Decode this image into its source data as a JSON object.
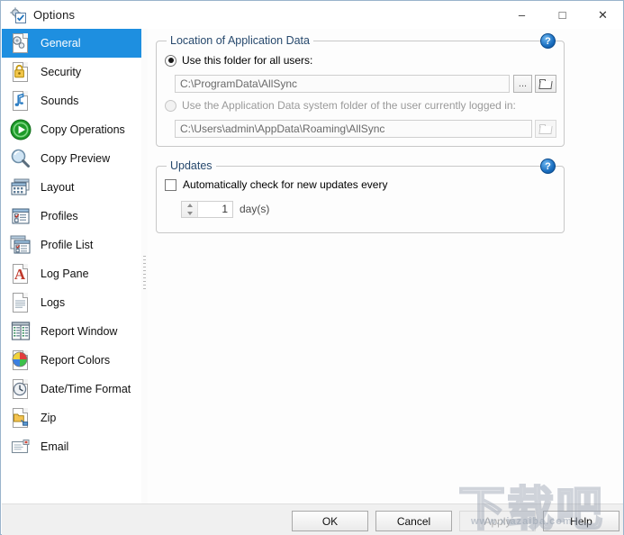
{
  "window": {
    "title": "Options",
    "icon": "options-gear-icon",
    "minimize": "–",
    "maximize": "□",
    "close": "✕"
  },
  "sidebar": {
    "items": [
      {
        "label": "General",
        "icon": "general-gear-page-icon",
        "selected": true
      },
      {
        "label": "Security",
        "icon": "padlock-page-icon",
        "selected": false
      },
      {
        "label": "Sounds",
        "icon": "music-note-page-icon",
        "selected": false
      },
      {
        "label": "Copy Operations",
        "icon": "green-play-circle-icon",
        "selected": false
      },
      {
        "label": "Copy Preview",
        "icon": "magnifier-icon",
        "selected": false
      },
      {
        "label": "Layout",
        "icon": "window-layout-icon",
        "selected": false
      },
      {
        "label": "Profiles",
        "icon": "profile-window-icon",
        "selected": false
      },
      {
        "label": "Profile List",
        "icon": "profile-list-windows-icon",
        "selected": false
      },
      {
        "label": "Log Pane",
        "icon": "red-letter-a-page-icon",
        "selected": false
      },
      {
        "label": "Logs",
        "icon": "lined-page-icon",
        "selected": false
      },
      {
        "label": "Report Window",
        "icon": "report-grid-icon",
        "selected": false
      },
      {
        "label": "Report Colors",
        "icon": "color-wheel-page-icon",
        "selected": false
      },
      {
        "label": "Date/Time Format",
        "icon": "clock-page-icon",
        "selected": false
      },
      {
        "label": "Zip",
        "icon": "zip-folder-icon",
        "selected": false
      },
      {
        "label": "Email",
        "icon": "envelope-icon",
        "selected": false
      }
    ]
  },
  "main": {
    "location_group": {
      "title": "Location of Application Data",
      "help_icon": "help-question-icon",
      "option_all_users": {
        "label": "Use this folder for all users:",
        "checked": true,
        "path_value": "C:\\ProgramData\\AllSync",
        "browse_dots_label": "...",
        "browse_folder_icon": "open-folder-icon"
      },
      "option_current_user": {
        "label": "Use the Application Data system folder of the user currently logged in:",
        "checked": false,
        "disabled": true,
        "path_value": "C:\\Users\\admin\\AppData\\Roaming\\AllSync",
        "browse_folder_icon": "open-folder-icon"
      }
    },
    "updates_group": {
      "title": "Updates",
      "help_icon": "help-question-icon",
      "auto_check": {
        "label": "Automatically check for new updates every",
        "checked": false
      },
      "interval": {
        "value": "1",
        "unit_label": "day(s)"
      }
    }
  },
  "footer": {
    "buttons": [
      {
        "label": "OK",
        "disabled": false
      },
      {
        "label": "Cancel",
        "disabled": false
      },
      {
        "label": "Apply",
        "disabled": true
      },
      {
        "label": "Help",
        "disabled": false
      }
    ]
  },
  "watermark": {
    "text": "下载吧",
    "url": "www.xiazaiba.com"
  }
}
